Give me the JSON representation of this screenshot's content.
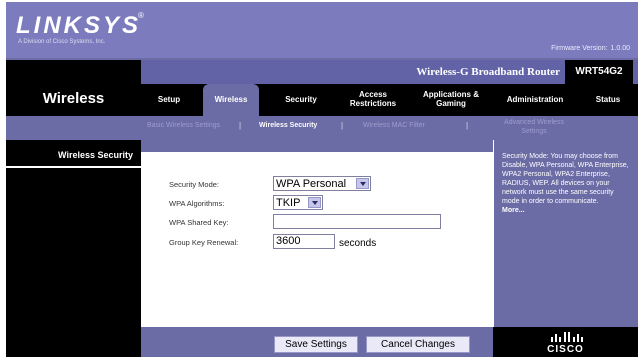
{
  "header": {
    "logo": "LINKSYS",
    "logo_reg": "®",
    "logo_sub": "A Division of Cisco Systems, Inc.",
    "firmware_label": "Firmware Version:",
    "firmware_version": "1.0.00",
    "product_name": "Wireless-G Broadband Router",
    "model": "WRT54G2"
  },
  "section_title": "Wireless",
  "tabs": [
    {
      "label": "Setup",
      "active": false
    },
    {
      "label": "Wireless",
      "active": true
    },
    {
      "label": "Security",
      "active": false
    },
    {
      "label": "Access Restrictions",
      "active": false
    },
    {
      "label": "Applications & Gaming",
      "active": false
    },
    {
      "label": "Administration",
      "active": false
    },
    {
      "label": "Status",
      "active": false
    }
  ],
  "subtabs": {
    "basic": "Basic Wireless Settings",
    "security": "Wireless Security",
    "mac": "Wireless MAC Filter",
    "advanced": "Advanced Wireless Settings",
    "sep": "|"
  },
  "left": {
    "heading": "Wireless Security"
  },
  "form": {
    "security_mode_label": "Security Mode:",
    "security_mode_value": "WPA Personal",
    "algorithm_label": "WPA Algorithms:",
    "algorithm_value": "TKIP",
    "shared_key_label": "WPA Shared  Key:",
    "shared_key_value": "",
    "renewal_label": "Group Key  Renewal:",
    "renewal_value": "3600",
    "renewal_unit": "seconds"
  },
  "help": {
    "text": "Security Mode: You may choose from Disable, WPA Personal, WPA Enterprise, WPA2 Personal, WPA2 Enterprise, RADIUS, WEP. All devices on your network must use the same security mode in order to communicate.",
    "more": "More..."
  },
  "buttons": {
    "save": "Save Settings",
    "cancel": "Cancel Changes"
  },
  "footer": {
    "brand": "CISCO"
  },
  "colors": {
    "purple": "#6b6ba6",
    "logo_band": "#7b7bbd",
    "black": "#000000"
  }
}
